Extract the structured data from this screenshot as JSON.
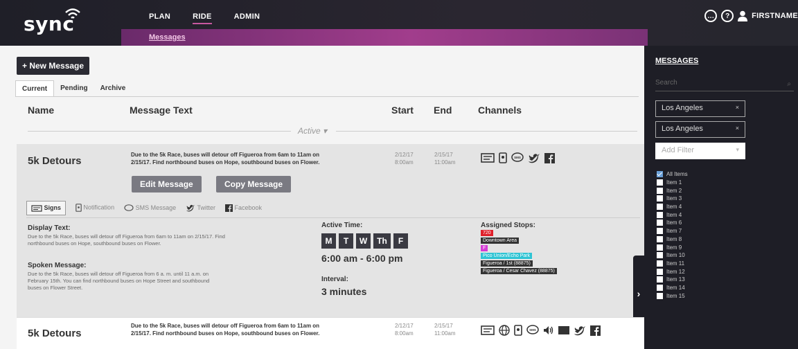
{
  "header": {
    "logo": "sync",
    "nav": [
      {
        "label": "PLAN"
      },
      {
        "label": "RIDE"
      },
      {
        "label": "ADMIN"
      }
    ],
    "subnav": "Messages",
    "user_label": "FIRSTNAME"
  },
  "main": {
    "new_message_label": "+ New Message",
    "tabs": [
      {
        "label": "Current"
      },
      {
        "label": "Pending"
      },
      {
        "label": "Archive"
      }
    ],
    "columns": {
      "name": "Name",
      "text": "Message Text",
      "start": "Start",
      "end": "End",
      "channels": "Channels"
    },
    "active_label": "Active ▾",
    "rows": [
      {
        "name": "5k Detours",
        "text_line1": "Due to the 5k Race, buses will detour off Figueroa from 6am to 11am on",
        "text_line2": "2/15/17. Find northbound buses on Hope, southbound buses on Flower.",
        "start_date": "2/12/17",
        "start_time": "8:00am",
        "end_date": "2/15/17",
        "end_time": "11:00am",
        "edit_label": "Edit Message",
        "copy_label": "Copy Message",
        "channel_tabs": [
          {
            "label": "Signs"
          },
          {
            "label": "Notification"
          },
          {
            "label": "SMS Message"
          },
          {
            "label": "Twitter"
          },
          {
            "label": "Facebook"
          }
        ],
        "display_text_label": "Display Text:",
        "display_text_line1": "Due to the 5k Race, buses will detour off Figueroa from 6am to 11am on 2/15/17. Find",
        "display_text_line2": "northbound buses on Hope, southbound buses on Flower.",
        "spoken_label": "Spoken Message:",
        "spoken_line1": "Due to the 5k Race, buses will detour off Figueroa from 6 a. m. until 11 a.m. on",
        "spoken_line2": "February 15th. You can find northbound buses on Hope Street and southbound",
        "spoken_line3": "buses on Flower Street.",
        "active_time_label": "Active Time:",
        "days": [
          "M",
          "T",
          "W",
          "Th",
          "F"
        ],
        "time_range": "6:00 am - 6:00 pm",
        "interval_label": "Interval:",
        "interval_value": "3 minutes",
        "assigned_label": "Assigned Stops:",
        "stops": [
          {
            "label": "720",
            "color": "#e0202a"
          },
          {
            "label": "Downtown Area",
            "color": "#333333"
          },
          {
            "label": "F",
            "color": "#d43ad4"
          },
          {
            "label": "Pico Union/Echo Park",
            "color": "#2fc4d4"
          },
          {
            "label": "Figueroa / 1st (88875)",
            "color": "#333333"
          },
          {
            "label": "Figueroa / Cesar Chavez (88875)",
            "color": "#333333"
          }
        ]
      },
      {
        "name": "5k Detours",
        "text_line1": "Due to the 5k Race, buses will detour off Figueroa from 6am to 11am on",
        "text_line2": "2/15/17. Find northbound buses on Hope, southbound buses on Flower.",
        "start_date": "2/12/17",
        "start_time": "8:00am",
        "end_date": "2/15/17",
        "end_time": "11:00am"
      }
    ]
  },
  "sidebar": {
    "title": "MESSAGES",
    "search_placeholder": "Search",
    "filters": [
      {
        "label": "Los Angeles"
      },
      {
        "label": "Los Angeles"
      }
    ],
    "add_filter_placeholder": "Add Filter",
    "items": [
      {
        "label": "All Items",
        "checked": true
      },
      {
        "label": "Item 1"
      },
      {
        "label": "Item 2"
      },
      {
        "label": "Item 3"
      },
      {
        "label": "Item 4"
      },
      {
        "label": "Item 4"
      },
      {
        "label": "Item 6"
      },
      {
        "label": "Item 7"
      },
      {
        "label": "Item 8"
      },
      {
        "label": "Item 9"
      },
      {
        "label": "Item 10"
      },
      {
        "label": "Item 11"
      },
      {
        "label": "Item 12"
      },
      {
        "label": "Item 13"
      },
      {
        "label": "Item 14"
      },
      {
        "label": "Item 15"
      }
    ]
  }
}
